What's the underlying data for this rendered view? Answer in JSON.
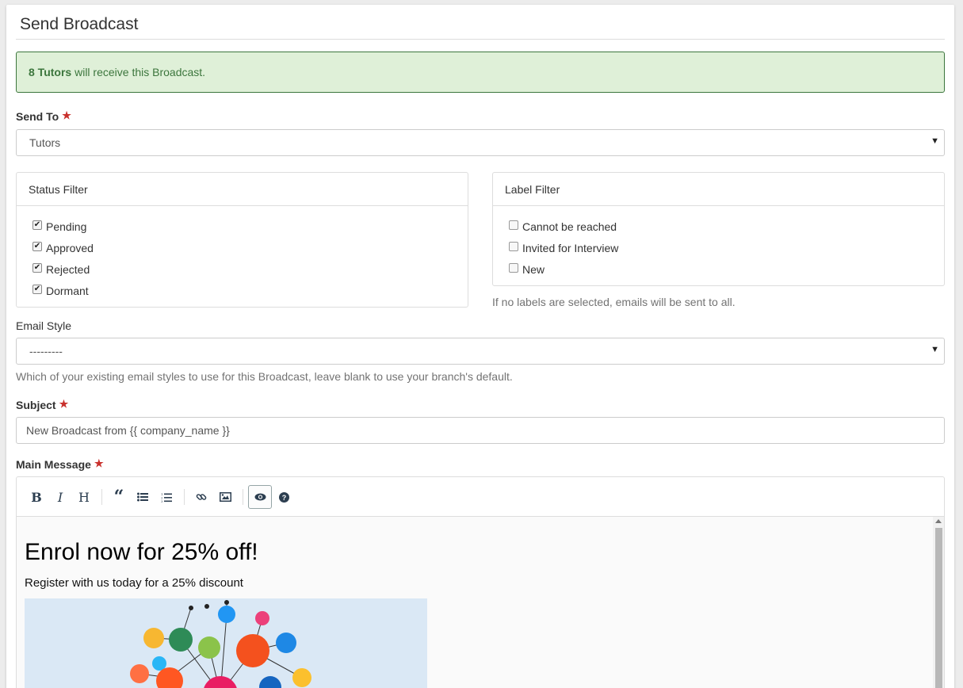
{
  "header": {
    "title": "Send Broadcast"
  },
  "alert": {
    "count_text": "8 Tutors",
    "rest_text": " will receive this Broadcast."
  },
  "send_to": {
    "label": "Send To",
    "value": "Tutors"
  },
  "status_filter": {
    "title": "Status Filter",
    "items": [
      {
        "label": "Pending",
        "checked": true
      },
      {
        "label": "Approved",
        "checked": true
      },
      {
        "label": "Rejected",
        "checked": true
      },
      {
        "label": "Dormant",
        "checked": true
      }
    ]
  },
  "label_filter": {
    "title": "Label Filter",
    "items": [
      {
        "label": "Cannot be reached",
        "checked": false
      },
      {
        "label": "Invited for Interview",
        "checked": false
      },
      {
        "label": "New",
        "checked": false
      }
    ],
    "help": "If no labels are selected, emails will be sent to all."
  },
  "email_style": {
    "label": "Email Style",
    "value": "---------",
    "help": "Which of your existing email styles to use for this Broadcast, leave blank to use your branch's default."
  },
  "subject": {
    "label": "Subject",
    "value": "New Broadcast from {{ company_name }}"
  },
  "main_message": {
    "label": "Main Message",
    "preview_heading": "Enrol now for 25% off!",
    "preview_text": "Register with us today for a 25% discount"
  },
  "colors": {
    "alert_bg": "#dff0d8",
    "alert_text": "#3c763d",
    "required_star": "#c9302c",
    "image_bg": "#dae8f5"
  }
}
